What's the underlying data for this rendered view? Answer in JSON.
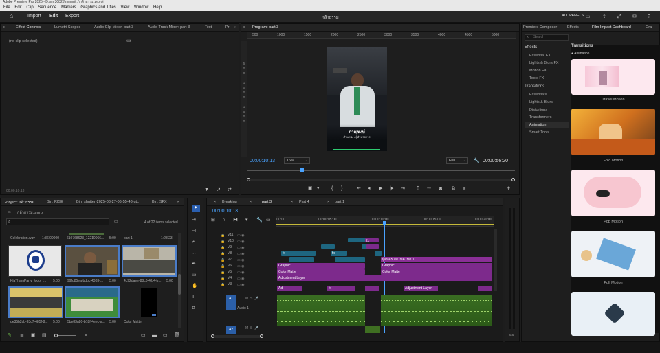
{
  "titlebar": {
    "text": "Adobe Premiere Pro 2025 - D:\\nn 30825\\nnmm\\...\\กล้าธรรม.prproj"
  },
  "menu": [
    "File",
    "Edit",
    "Clip",
    "Sequence",
    "Markers",
    "Graphics and Titles",
    "View",
    "Window",
    "Help"
  ],
  "topbar": {
    "import": "Import",
    "edit": "Edit",
    "export": "Export",
    "project_name": "กล้าธรรม",
    "all_panels": "ALL PANELS"
  },
  "effect_controls": {
    "tabs": [
      "Effect Controls",
      "Lumetri Scopes",
      "Audio Clip Mixer: part 3",
      "Audio Track Mixer: part 3",
      "Text",
      "Pr"
    ],
    "no_clip": "(no clip selected)",
    "timecode": "00:00:10:13"
  },
  "program": {
    "tab": "Program: part 3",
    "ruler": [
      "500",
      "1000",
      "1500",
      "2000",
      "2500",
      "3000",
      "3500",
      "4000",
      "4500",
      "5000"
    ],
    "timecode": "00:00:10:13",
    "zoom": "16%",
    "quality": "Full",
    "duration": "00:00:56:20",
    "overlay_title": "ภาณุพงษ์",
    "overlay_sub": "ตำแหน่ง / ผู้อำนวยการ",
    "vertical_ruler": [
      "5",
      "0",
      "0",
      "1",
      "0",
      "0",
      "0",
      "1",
      "5",
      "0",
      "0"
    ]
  },
  "project": {
    "tabs": [
      "Project: กล้าธรรม",
      "Bin: RISE",
      "Bin: shutter-2025-08-27-06-55-48-utc",
      "Bin: SFX"
    ],
    "file": "กล้าธรรม.prproj",
    "count": "4 of 22 items selected",
    "rows": [
      {
        "name": "Celebration.wav",
        "dur": "1:36:00000"
      },
      {
        "name": "610768623_12210066...",
        "dur": "5:00"
      },
      {
        "name": "part 1",
        "dur": "1:28:23"
      }
    ],
    "items": [
      {
        "name": "KlaThamParty_logo_[...",
        "dur": "5:00"
      },
      {
        "name": "99fd85ea-bdbc-4303-...",
        "dur": "5:00"
      },
      {
        "name": "4c92daee-88c0-4fb4-b...",
        "dur": "5:00"
      },
      {
        "name": "de35b2cb-93c7-485f-8...",
        "dur": "5:00"
      },
      {
        "name": "5be83a80-b18f-4eec-a...",
        "dur": "5:00"
      },
      {
        "name": "Color Matte",
        "dur": ""
      }
    ]
  },
  "timeline": {
    "tabs": [
      "Breaking",
      "part 3",
      "Part 4",
      "part 1"
    ],
    "timecode": "00:00:10:13",
    "ruler": [
      ":00:00",
      "00:00:05:00",
      "00:00:10:00",
      "00:00:15:00",
      "00:00:20:00"
    ],
    "video_tracks": [
      "V11",
      "V10",
      "V9",
      "V8",
      "V7",
      "V6",
      "V5",
      "V4",
      "V3"
    ],
    "audio_tracks": [
      "A1",
      "A2"
    ],
    "audio_label": "Audio 1",
    "clips": {
      "graphic": "Graphic",
      "color_matte": "Color Matte",
      "adjustment": "Adjustment Layer",
      "adj_short": "Adj",
      "thai_title": "ผู้สมัคร สส.เขต เขต 1",
      "fx": "fx"
    }
  },
  "effects_panel": {
    "tabs": [
      "Premiere Composer",
      "Effects",
      "Film Impact Dashboard",
      "Graj"
    ],
    "search_placeholder": "Search",
    "sections": [
      {
        "head": "Effects",
        "items": [
          "Essential FX",
          "Lights & Blurs FX",
          "Motion FX",
          "Tools FX"
        ]
      },
      {
        "head": "Transitions",
        "items": [
          "Essentials",
          "Lights & Blurs",
          "Distortions",
          "Transformers",
          "Animation",
          "Smart Tools"
        ]
      }
    ],
    "selected_item": "Animation",
    "right_head": "Transitions",
    "right_sub": "Animation",
    "cards": [
      "Travel Motion",
      "Fold Motion",
      "Pop Motion",
      "Pull Motion",
      ""
    ]
  },
  "audio_meter": {
    "label": "S S"
  },
  "colors": {
    "accent": "#4aa3ff",
    "clip_purple": "#7d2a8c",
    "clip_teal": "#1e6680",
    "audio_green": "#3f6f22"
  }
}
